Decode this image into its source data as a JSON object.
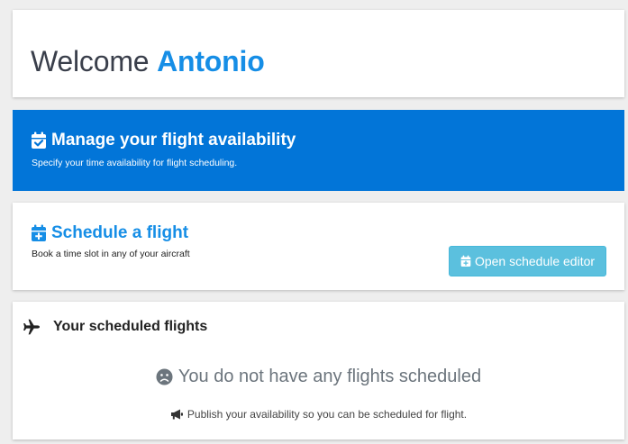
{
  "welcome": {
    "greeting": "Welcome",
    "user_name": "Antonio"
  },
  "availability": {
    "title": "Manage your flight availability",
    "description": "Specify your time availability for flight scheduling.",
    "icon": "calendar-check-icon",
    "background_color": "#0275d8"
  },
  "schedule": {
    "title": "Schedule a flight",
    "description": "Book a time slot in any of your aircraft",
    "icon": "calendar-plus-icon",
    "button_label": "Open schedule editor",
    "button_color": "#5bc0de"
  },
  "flights": {
    "title": "Your scheduled flights",
    "icon": "plane-icon",
    "empty_message": "You do not have any flights scheduled",
    "empty_icon": "frown-icon",
    "note": "Publish your availability so you can be scheduled for flight.",
    "note_icon": "megaphone-icon"
  },
  "colors": {
    "accent": "#168ee6",
    "page_background": "#eeeeee"
  }
}
